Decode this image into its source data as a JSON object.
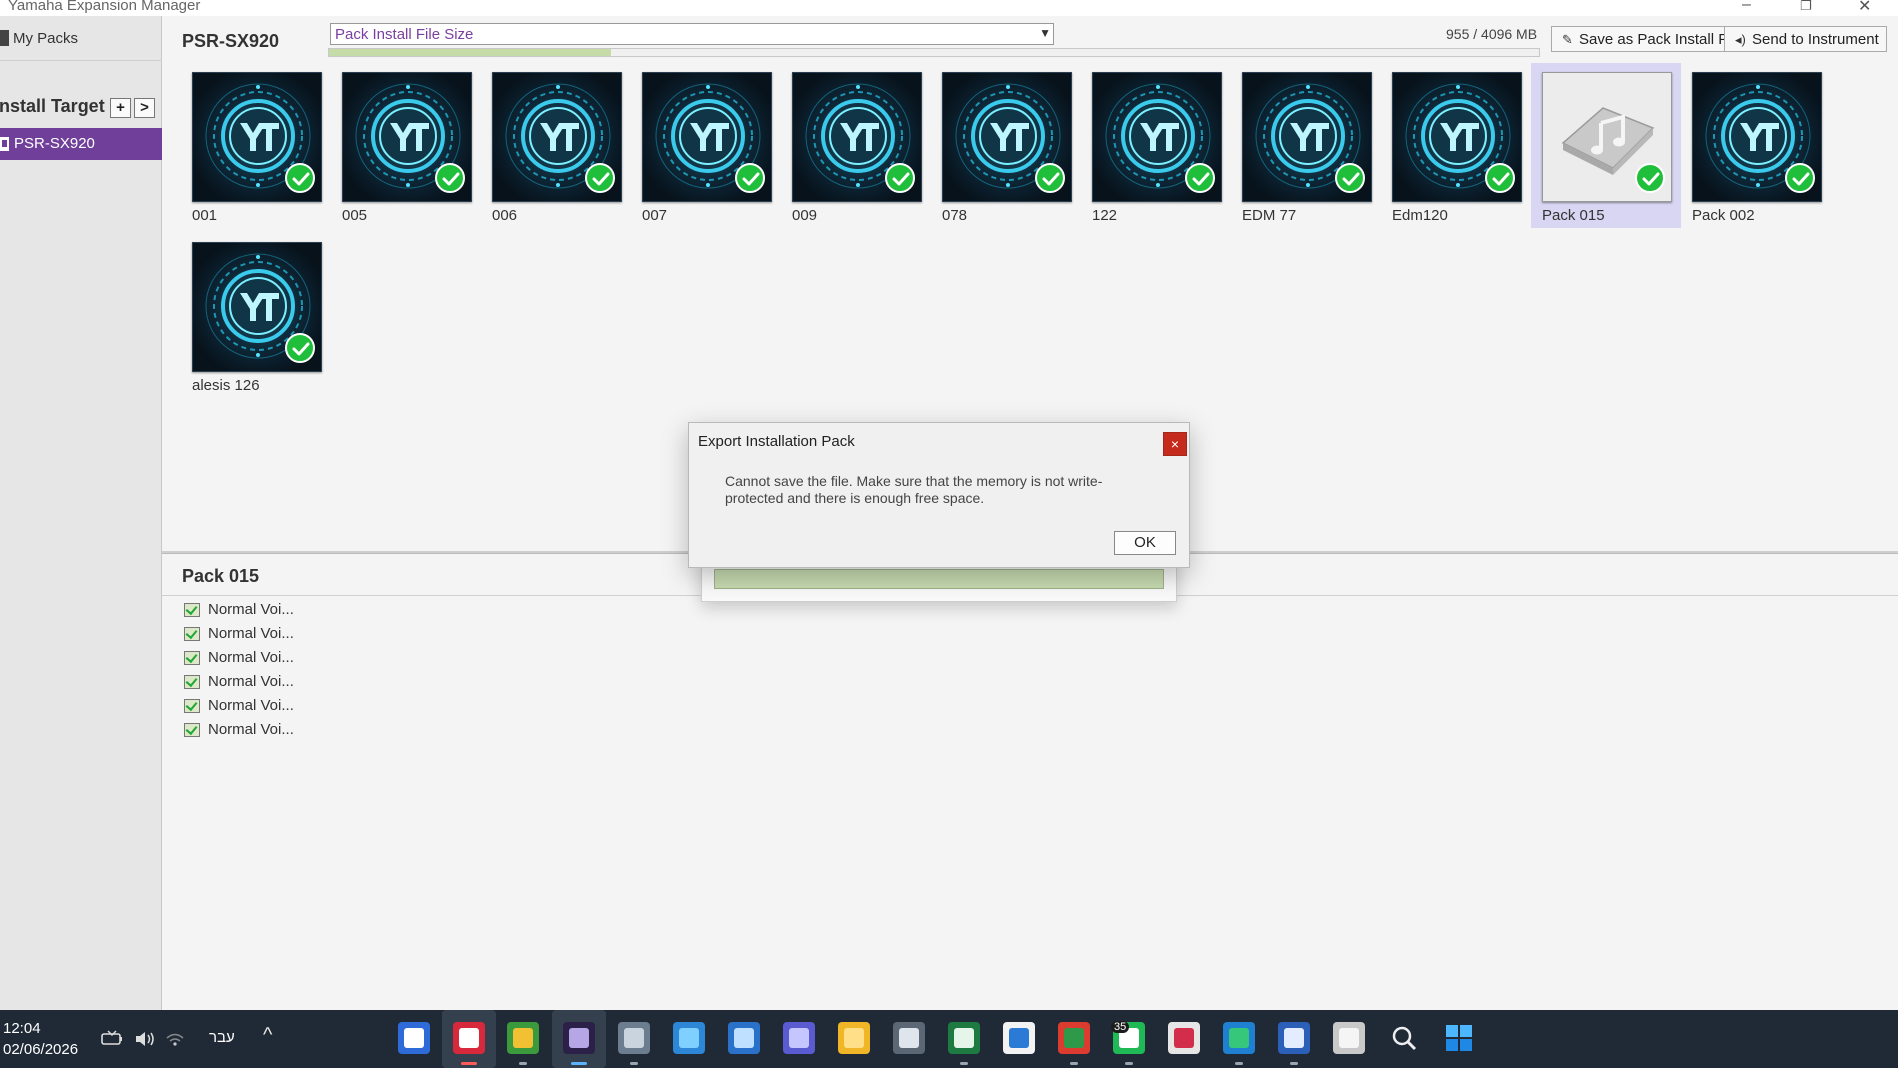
{
  "window": {
    "title": "Yamaha Expansion Manager",
    "controls": {
      "minimize": "–",
      "maximize": "❐",
      "close": "✕"
    }
  },
  "sidebar": {
    "my_packs": "My Packs",
    "install_target_label": "Install Target",
    "add_button": "+",
    "next_button": ">",
    "targets": [
      {
        "label": "PSR-SX920",
        "selected": true
      }
    ]
  },
  "header": {
    "instrument": "PSR-SX920",
    "size_select": {
      "value": "Pack Install File Size",
      "arrow": "▼"
    },
    "memory_readout": "955 / 4096 MB",
    "memory_used_fraction": 0.233,
    "save_button": {
      "label": "Save as Pack Install File",
      "icon": "pen-icon"
    },
    "send_button": {
      "label": "Send to Instrument",
      "icon": "send-icon"
    }
  },
  "packs": [
    {
      "name": "001",
      "icon": "yt-logo",
      "installed": true
    },
    {
      "name": "005",
      "icon": "yt-logo",
      "installed": true
    },
    {
      "name": "006",
      "icon": "yt-logo",
      "installed": true
    },
    {
      "name": "007",
      "icon": "yt-logo",
      "installed": true
    },
    {
      "name": "009",
      "icon": "yt-logo",
      "installed": true
    },
    {
      "name": "078",
      "icon": "yt-logo",
      "installed": true
    },
    {
      "name": "122",
      "icon": "yt-logo",
      "installed": true
    },
    {
      "name": "EDM 77",
      "icon": "yt-logo",
      "installed": true
    },
    {
      "name": "Edm120",
      "icon": "yt-logo",
      "installed": true
    },
    {
      "name": "Pack 015",
      "icon": "music-folder",
      "installed": true,
      "selected": true
    },
    {
      "name": "Pack 002",
      "icon": "yt-logo",
      "installed": true
    },
    {
      "name": "alesis 126",
      "icon": "yt-logo",
      "installed": true
    }
  ],
  "detail": {
    "title": "Pack 015",
    "items": [
      "Normal Voi...",
      "Normal Voi...",
      "Normal Voi...",
      "Normal Voi...",
      "Normal Voi...",
      "Normal Voi..."
    ]
  },
  "dialog": {
    "title": "Export Installation Pack",
    "close_label": "×",
    "message": "Cannot save the file. Make sure that the memory is not write-protected and there is enough free space.",
    "ok_label": "OK"
  },
  "taskbar": {
    "time": "12:04",
    "date": "02/06/2026",
    "language": "עבר",
    "chevron": "^",
    "whatsapp_badge": "35",
    "colors": {
      "background": "#202a36",
      "accent_purple": "#6f3f9a",
      "check_green": "#1fbf3c"
    }
  }
}
